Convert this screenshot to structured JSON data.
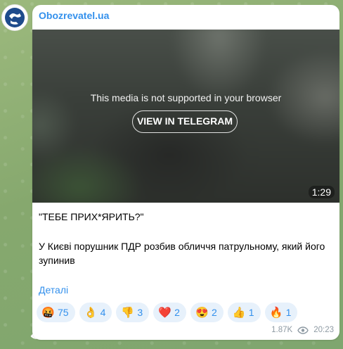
{
  "channel": {
    "name": "Obozrevatel.ua"
  },
  "media": {
    "notice": "This media is not supported in your browser",
    "button_label": "VIEW IN TELEGRAM",
    "duration": "1:29"
  },
  "post": {
    "headline": "\"ТЕБЕ ПРИХ*ЯРИТЬ?\"",
    "body": "У Києві порушник ПДР розбив обличчя патрульному, який його зупинив",
    "details_link": "Деталі"
  },
  "reactions": [
    {
      "emoji": "🤬",
      "count": "75"
    },
    {
      "emoji": "👌",
      "count": "4"
    },
    {
      "emoji": "👎",
      "count": "3"
    },
    {
      "emoji": "❤️",
      "count": "2"
    },
    {
      "emoji": "😍",
      "count": "2"
    },
    {
      "emoji": "👍",
      "count": "1"
    },
    {
      "emoji": "🔥",
      "count": "1"
    }
  ],
  "meta": {
    "views": "1.87K",
    "time": "20:23",
    "views_icon": "eye-icon"
  },
  "colors": {
    "link": "#3390ec",
    "reaction_bg": "#e7f1fb"
  }
}
